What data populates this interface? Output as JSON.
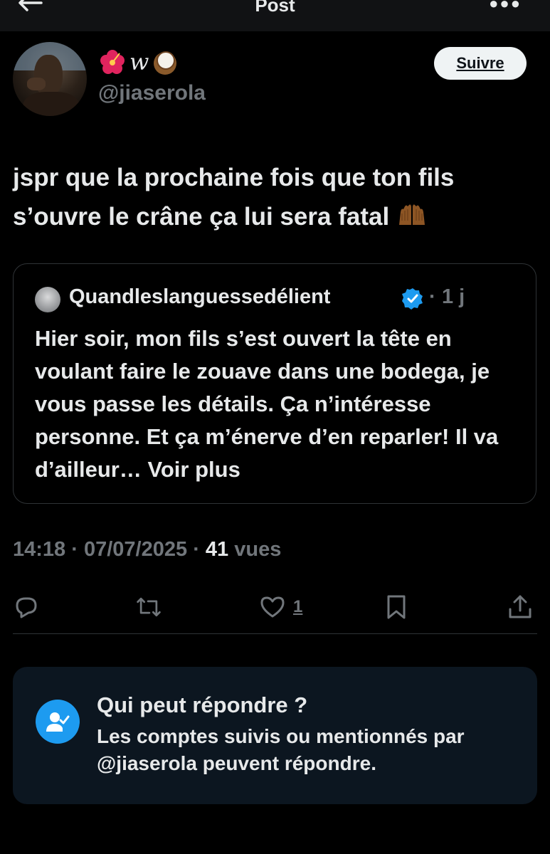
{
  "header": {
    "title": "Post",
    "back_icon": "arrow-left-icon",
    "more_icon": "more-dots-icon"
  },
  "author": {
    "display_name": "w",
    "display_name_emoji": [
      "hibiscus-icon",
      "coconut-icon"
    ],
    "handle": "@jiaserola",
    "follow_label": "Suivre"
  },
  "post": {
    "text": "jspr que la prochaine fois que ton fils s’ouvre le crâne ça lui sera fatal",
    "trailing_emoji": "raised-hands-icon"
  },
  "quote": {
    "name": "Quandleslanguessedélient",
    "separator": "·",
    "time": "1 j",
    "text": "Hier soir, mon fils s’est ouvert la tête en voulant faire le zouave dans une bodega, je vous passe les détails. Ça n’intéresse personne. Et ça m’énerve d’en reparler! Il va d’ailleur… Voir plus"
  },
  "meta": {
    "time": "14:18",
    "sep1": "·",
    "date": "07/07/2025",
    "sep2": "·",
    "views_count": "41",
    "views_label": "vues"
  },
  "actions": {
    "like_count": "1"
  },
  "reply_info": {
    "title": "Qui peut répondre ?",
    "description": "Les comptes suivis ou mentionnés par @jiaserola peuvent répondre."
  },
  "colors": {
    "background": "#000000",
    "text": "#e7e9ea",
    "muted": "#71767b",
    "accent": "#1d9bf0",
    "card": "#0c1620",
    "border": "#2f3336"
  }
}
